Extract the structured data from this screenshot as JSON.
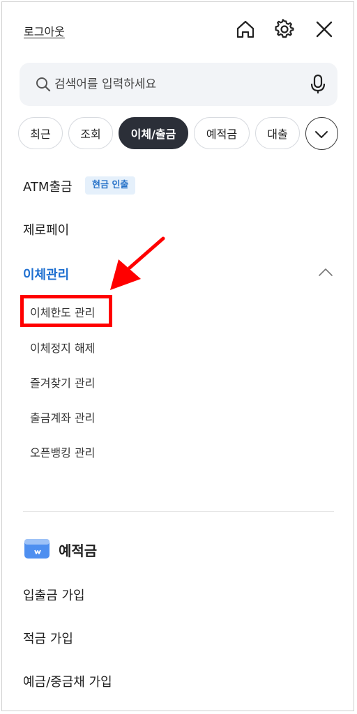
{
  "header": {
    "logout_label": "로그아웃",
    "home_icon": "home-icon",
    "settings_icon": "gear-icon",
    "close_icon": "close-icon"
  },
  "search": {
    "placeholder": "검색어를 입력하세요",
    "search_icon": "search-icon",
    "mic_icon": "microphone-icon"
  },
  "chips": [
    {
      "label": "최근",
      "active": false
    },
    {
      "label": "조회",
      "active": false
    },
    {
      "label": "이체/출금",
      "active": true
    },
    {
      "label": "예적금",
      "active": false
    },
    {
      "label": "대출",
      "active": false
    }
  ],
  "chips_more_icon": "chevron-down-icon",
  "menu": {
    "atm": {
      "label": "ATM출금",
      "badge": "현금 인출"
    },
    "zeropay": {
      "label": "제로페이"
    },
    "transfer_mgmt": {
      "label": "이체관리",
      "expanded_icon": "chevron-up-icon",
      "items": [
        "이체한도 관리",
        "이체정지 해제",
        "즐겨찾기 관리",
        "출금계좌 관리",
        "오픈뱅킹 관리"
      ]
    }
  },
  "deposit_section": {
    "title": "예적금",
    "icon": "wallet-icon",
    "items": [
      "입출금 가입",
      "적금 가입",
      "예금/중금채 가입"
    ]
  },
  "colors": {
    "accent_blue": "#1e6fd0",
    "active_chip": "#2b2f38",
    "badge_bg": "#e5f0fb",
    "annotation_red": "#ff0000"
  }
}
